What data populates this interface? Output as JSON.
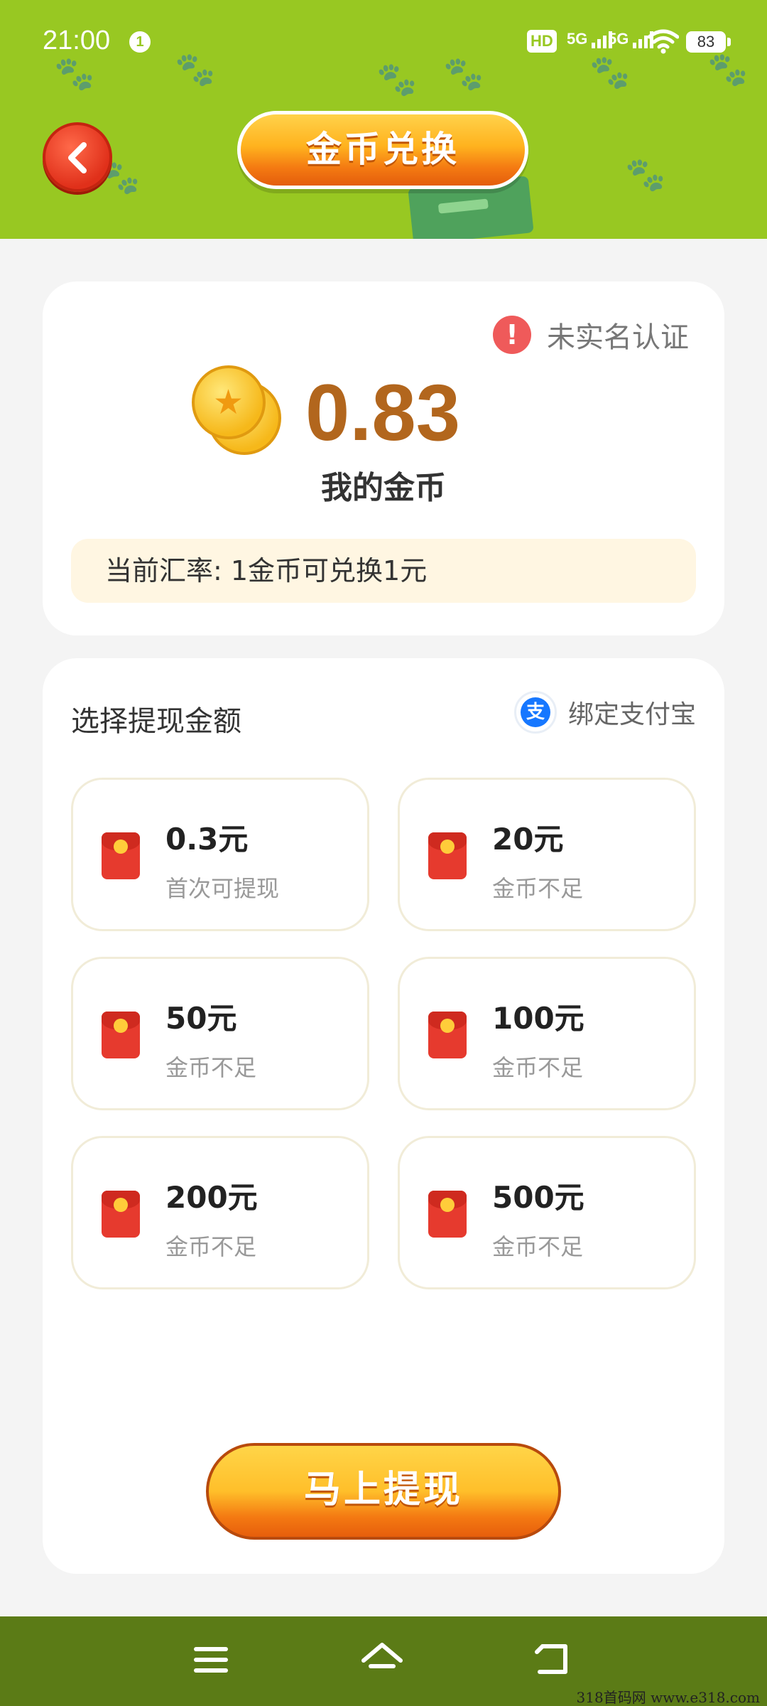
{
  "status_bar": {
    "time": "21:00",
    "notification_count": "1",
    "hd_label": "HD",
    "network_1": "5G",
    "network_2": "5G",
    "battery": "83"
  },
  "header": {
    "title": "金币兑换",
    "back_icon": "chevron-left-icon"
  },
  "balance_card": {
    "verify_status": "未实名认证",
    "coin_amount": "0.83",
    "coin_label": "我的金币",
    "rate_text": "当前汇率: 1金币可兑换1元"
  },
  "withdraw_card": {
    "section_title": "选择提现金额",
    "alipay_icon_text": "支",
    "alipay_label": "绑定支付宝",
    "amounts": [
      {
        "value": "0.3元",
        "status": "首次可提现"
      },
      {
        "value": "20元",
        "status": "金币不足"
      },
      {
        "value": "50元",
        "status": "金币不足"
      },
      {
        "value": "100元",
        "status": "金币不足"
      },
      {
        "value": "200元",
        "status": "金币不足"
      },
      {
        "value": "500元",
        "status": "金币不足"
      }
    ],
    "withdraw_button": "马上提现"
  },
  "nav": {
    "menu_icon": "menu-icon",
    "home_icon": "home-icon",
    "back_icon": "back-icon"
  },
  "watermark": "318首码网  www.e318.com",
  "colors": {
    "header_green": "#98c822",
    "nav_green": "#5b7b16",
    "balance_brown": "#b2661d",
    "button_orange": "#f47a12"
  }
}
